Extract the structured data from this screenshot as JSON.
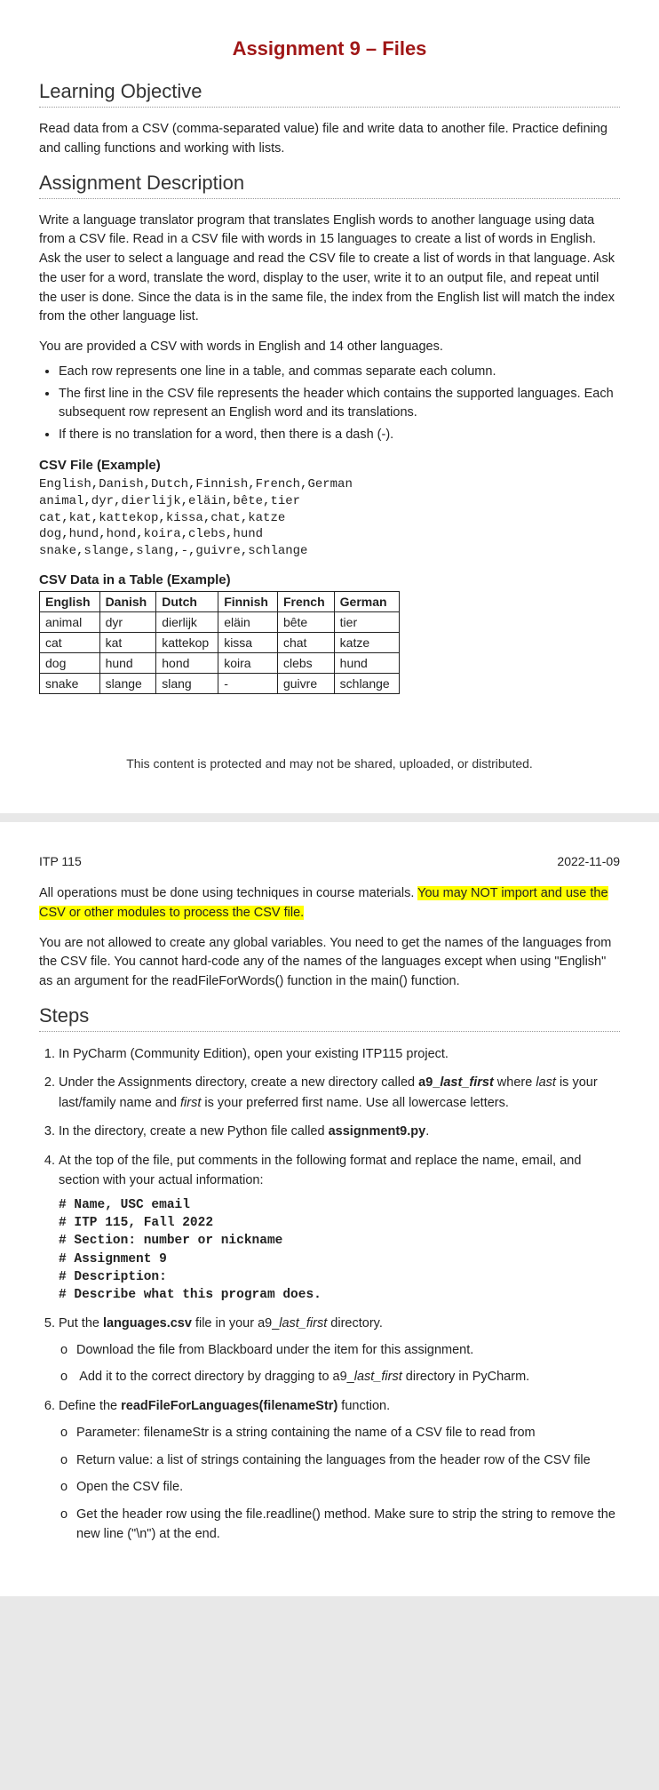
{
  "title": "Assignment 9 – Files",
  "sec_learning": "Learning Objective",
  "learning_text": "Read data from a CSV (comma-separated value) file and write data to another file. Practice defining and calling functions and working with lists.",
  "sec_desc": "Assignment Description",
  "desc_p1": "Write a language translator program that translates English words to another language using data from a CSV file. Read in a CSV file with words in 15 languages to create a list of words in English. Ask the user to select a language and read the CSV file to create a list of words in that language. Ask the user for a word, translate the word, display to the user, write it to an output file, and repeat until the user is done. Since the data is in the same file, the index from the English list will match the index from the other language list.",
  "desc_p2": "You are provided a CSV with words in English and 14 other languages.",
  "desc_bul1": "Each row represents one line in a table, and commas separate each column.",
  "desc_bul2": "The first line in the CSV file represents the header which contains the supported languages. Each subsequent row represent an English word and its translations.",
  "desc_bul3": "If there is no translation for a word, then there is a dash (-).",
  "csv_head": "CSV File (Example)",
  "csv_block": "English,Danish,Dutch,Finnish,French,German\nanimal,dyr,dierlijk,eläin,bête,tier\ncat,kat,kattekop,kissa,chat,katze\ndog,hund,hond,koira,clebs,hund\nsnake,slange,slang,-,guivre,schlange",
  "table_head": "CSV Data in a Table (Example)",
  "tbl": {
    "h": [
      "English",
      "Danish",
      "Dutch",
      "Finnish",
      "French",
      "German"
    ],
    "r": [
      [
        "animal",
        "dyr",
        "dierlijk",
        "eläin",
        "bête",
        "tier"
      ],
      [
        "cat",
        "kat",
        "kattekop",
        "kissa",
        "chat",
        "katze"
      ],
      [
        "dog",
        "hund",
        "hond",
        "koira",
        "clebs",
        "hund"
      ],
      [
        "snake",
        "slange",
        "slang",
        "-",
        "guivre",
        "schlange"
      ]
    ]
  },
  "footer": "This content is protected and may not be shared, uploaded, or distributed.",
  "course": "ITP 115",
  "date": "2022-11-09",
  "p2_a": "All operations must be done using techniques in course materials. ",
  "p2_hl": "You may NOT import and use the CSV or other modules to process the CSV file.",
  "p2_b": "You are not allowed to create any global variables. You need to get the names of the languages from the CSV file. You cannot hard-code any of the names of the languages except when using \"English\" as an argument for the readFileForWords() function in the main() function.",
  "sec_steps": "Steps",
  "s1": "In PyCharm (Community Edition), open your existing ITP115 project.",
  "s2a": "Under the Assignments directory, create a new directory called ",
  "s2b": "a9_last_first",
  "s2c": " where ",
  "s2d": "last",
  "s2e": " is your last/family name and ",
  "s2f": "first",
  "s2g": " is your preferred first name. Use all lowercase letters.",
  "s3a": "In the directory, create a new Python file called ",
  "s3b": "assignment9.py",
  "s3c": ".",
  "s4": "At the top of the file, put comments in the following format and replace the name, email, and section with your actual information:",
  "code4": "# Name, USC email\n# ITP 115, Fall 2022\n# Section: number or nickname\n# Assignment 9\n# Description:\n# Describe what this program does.",
  "s5a": "Put the ",
  "s5b": "languages.csv",
  "s5c": " file in your a9_",
  "s5d": "last_first",
  "s5e": " directory.",
  "s5s1": "Download the file from Blackboard under the item for this assignment.",
  "s5s2a": "Add it to the correct directory by dragging to a9_",
  "s5s2b": "last_first",
  "s5s2c": " directory in PyCharm.",
  "s6a": "Define the ",
  "s6b": "readFileForLanguages(filenameStr)",
  "s6c": " function.",
  "s6s1": "Parameter: filenameStr is a string containing the name of a CSV file to read from",
  "s6s2": "Return value: a list of strings containing the languages from the header row of the CSV file",
  "s6s3": "Open the CSV file.",
  "s6s4": "Get the header row using the file.readline() method. Make sure to strip the string to remove the new line (\"\\n\") at the end."
}
